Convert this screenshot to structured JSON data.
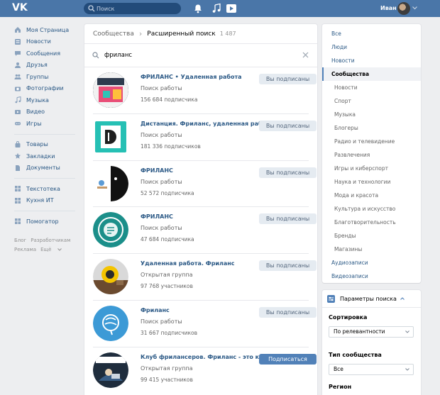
{
  "header": {
    "logo_text": "VK",
    "search_placeholder": "Поиск",
    "user_name": "Иван"
  },
  "sidebar": {
    "items": [
      {
        "label": "Моя Страница",
        "icon": "home-icon"
      },
      {
        "label": "Новости",
        "icon": "news-icon"
      },
      {
        "label": "Сообщения",
        "icon": "messages-icon"
      },
      {
        "label": "Друзья",
        "icon": "friends-icon"
      },
      {
        "label": "Группы",
        "icon": "groups-icon"
      },
      {
        "label": "Фотографии",
        "icon": "camera-icon"
      },
      {
        "label": "Музыка",
        "icon": "music-icon"
      },
      {
        "label": "Видео",
        "icon": "video-icon"
      },
      {
        "label": "Игры",
        "icon": "games-icon"
      }
    ],
    "items2": [
      {
        "label": "Товары",
        "icon": "goods-icon"
      },
      {
        "label": "Закладки",
        "icon": "bookmark-icon"
      },
      {
        "label": "Документы",
        "icon": "documents-icon"
      }
    ],
    "items3": [
      {
        "label": "Текстотека",
        "icon": "app-icon"
      },
      {
        "label": "Кухня ИТ",
        "icon": "app-icon"
      }
    ],
    "items4": [
      {
        "label": "Помогатор",
        "icon": "app-icon"
      }
    ],
    "footer": [
      "Блог",
      "Разработчикам",
      "Реклама",
      "Ещё"
    ]
  },
  "main": {
    "breadcrumb_link": "Сообщества",
    "title": "Расширенный поиск",
    "count": "1 487",
    "query": "фриланс",
    "results": [
      {
        "name": "ФРИЛАНС • Удаленная работа",
        "type": "Поиск работы",
        "subs": "156 684 подписчика",
        "button": "Вы подписаны",
        "primary": false
      },
      {
        "name": "Дистанция. Фриланс, удаленная работа",
        "type": "Поиск работы",
        "subs": "181 336 подписчиков",
        "button": "Вы подписаны",
        "primary": false
      },
      {
        "name": "ФРИЛАНС",
        "type": "Поиск работы",
        "subs": "52 572 подписчика",
        "button": "Вы подписаны",
        "primary": false
      },
      {
        "name": "ФРИЛАНС",
        "type": "Поиск работы",
        "subs": "47 684 подписчика",
        "button": "Вы подписаны",
        "primary": false
      },
      {
        "name": "Удаленная работа. Фриланс",
        "type": "Открытая группа",
        "subs": "97 768 участников",
        "button": "Вы подписаны",
        "primary": false
      },
      {
        "name": "Фриланс",
        "type": "Поиск работы",
        "subs": "31 667 подписчиков",
        "button": "Вы подписаны",
        "primary": false
      },
      {
        "name": "Клуб фрилансеров. Фриланс - это круто!",
        "type": "Открытая группа",
        "subs": "99 415 участников",
        "button": "Подписаться",
        "primary": true
      }
    ]
  },
  "filter": {
    "items": [
      {
        "label": "Все",
        "kind": "top"
      },
      {
        "label": "Люди",
        "kind": "top"
      },
      {
        "label": "Новости",
        "kind": "top"
      },
      {
        "label": "Сообщества",
        "kind": "active"
      },
      {
        "label": "Новости",
        "kind": "sub"
      },
      {
        "label": "Спорт",
        "kind": "sub"
      },
      {
        "label": "Музыка",
        "kind": "sub"
      },
      {
        "label": "Блогеры",
        "kind": "sub"
      },
      {
        "label": "Радио и телевидение",
        "kind": "sub"
      },
      {
        "label": "Развлечения",
        "kind": "sub"
      },
      {
        "label": "Игры и киберспорт",
        "kind": "sub"
      },
      {
        "label": "Наука и технологии",
        "kind": "sub"
      },
      {
        "label": "Мода и красота",
        "kind": "sub"
      },
      {
        "label": "Культура и искусство",
        "kind": "sub"
      },
      {
        "label": "Благотворительность",
        "kind": "sub"
      },
      {
        "label": "Бренды",
        "kind": "sub"
      },
      {
        "label": "Магазины",
        "kind": "sub"
      },
      {
        "label": "Аудиозаписи",
        "kind": "top"
      },
      {
        "label": "Видеозаписи",
        "kind": "top"
      }
    ]
  },
  "params": {
    "title": "Параметры поиска",
    "sort_label": "Сортировка",
    "sort_value": "По релевантности",
    "type_label": "Тип сообщества",
    "type_value": "Все",
    "region_label": "Регион"
  },
  "colors": {
    "header": "#4a76a8",
    "link": "#2a5885",
    "button_primary": "#5181b8",
    "button_secondary": "#e5ebf1"
  }
}
